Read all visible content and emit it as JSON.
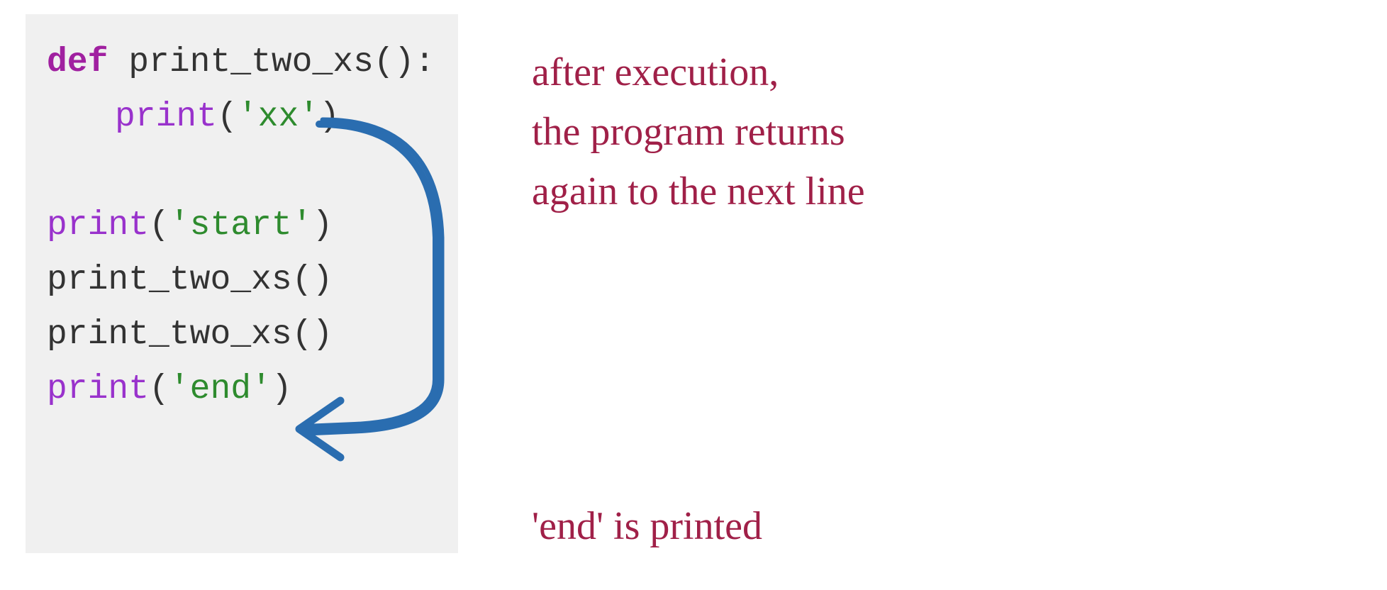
{
  "code": {
    "line1_def": "def",
    "line1_name": " print_two_xs",
    "line1_end": "():",
    "line2_fn": "print",
    "line2_paren_open": "(",
    "line2_str": "'xx'",
    "line2_paren_close": ")",
    "line4_fn": "print",
    "line4_paren_open": "(",
    "line4_str": "'start'",
    "line4_paren_close": ")",
    "line5": "print_two_xs()",
    "line6": "print_two_xs()",
    "line7_fn": "print",
    "line7_paren_open": "(",
    "line7_str": "'end'",
    "line7_paren_close": ")"
  },
  "annotations": {
    "top_line1": "after execution,",
    "top_line2": "the program returns",
    "top_line3": "again to the next line",
    "bottom": "'end' is printed"
  },
  "colors": {
    "code_bg": "#f0f0f0",
    "keyword": "#a020a0",
    "function": "#9932cc",
    "string": "#2e8b2e",
    "text": "#333333",
    "annotation": "#a02048",
    "arrow": "#2a6db0"
  }
}
